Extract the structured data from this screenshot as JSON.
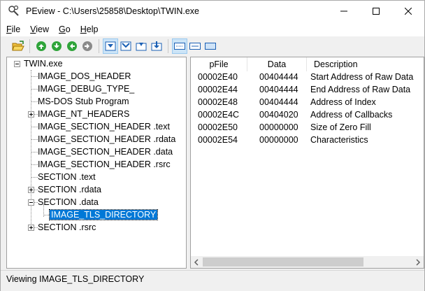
{
  "window": {
    "title": "PEview - C:\\Users\\25858\\Desktop\\TWIN.exe"
  },
  "menu": [
    {
      "first": "F",
      "rest": "ile"
    },
    {
      "first": "V",
      "rest": "iew"
    },
    {
      "first": "G",
      "rest": "o"
    },
    {
      "first": "H",
      "rest": "elp"
    }
  ],
  "toolbar": {
    "buttons": [
      "open-icon",
      "up-icon",
      "down-icon",
      "back-icon",
      "forward-icon",
      "view-1-icon",
      "view-2-icon",
      "view-3-icon",
      "view-4-icon",
      "layout-1-icon",
      "layout-2-icon",
      "layout-3-icon"
    ],
    "active_layout": "layout-1-icon"
  },
  "tree": {
    "root": "TWIN.exe",
    "items": [
      "IMAGE_DOS_HEADER",
      "IMAGE_DEBUG_TYPE_",
      "MS-DOS Stub Program",
      "IMAGE_NT_HEADERS",
      "IMAGE_SECTION_HEADER .text",
      "IMAGE_SECTION_HEADER .rdata",
      "IMAGE_SECTION_HEADER .data",
      "IMAGE_SECTION_HEADER .rsrc",
      "SECTION .text",
      "SECTION .rdata",
      "SECTION .data",
      "IMAGE_TLS_DIRECTORY",
      "SECTION .rsrc"
    ]
  },
  "list": {
    "headers": [
      "pFile",
      "Data",
      "Description"
    ],
    "rows": [
      [
        "00002E40",
        "00404444",
        "Start Address of Raw Data"
      ],
      [
        "00002E44",
        "00404444",
        "End Address of Raw Data"
      ],
      [
        "00002E48",
        "00404444",
        "Address of Index"
      ],
      [
        "00002E4C",
        "00404020",
        "Address of Callbacks"
      ],
      [
        "00002E50",
        "00000000",
        "Size of Zero Fill"
      ],
      [
        "00002E54",
        "00000000",
        "Characteristics"
      ]
    ]
  },
  "status": {
    "text": "Viewing IMAGE_TLS_DIRECTORY"
  },
  "colors": {
    "selection": "#0078d7",
    "window_bg": "#f0f0f0",
    "toolbar_active": "#cce4f7"
  }
}
